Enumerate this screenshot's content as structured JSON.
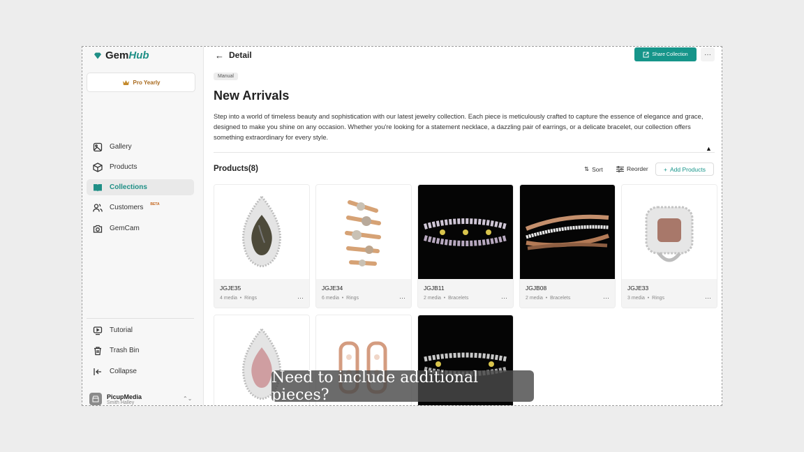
{
  "app": {
    "logo_main": "Gem",
    "logo_accent": "Hub",
    "plan": "Pro Yearly"
  },
  "sidebar": {
    "items": [
      {
        "label": "Gallery",
        "icon": "image-icon"
      },
      {
        "label": "Products",
        "icon": "box-icon"
      },
      {
        "label": "Collections",
        "icon": "book-icon",
        "active": true
      },
      {
        "label": "Customers",
        "icon": "users-icon",
        "badge": "BETA"
      },
      {
        "label": "GemCam",
        "icon": "camera-icon"
      }
    ],
    "bottom": [
      {
        "label": "Tutorial",
        "icon": "tutorial-icon"
      },
      {
        "label": "Trash Bin",
        "icon": "trash-icon"
      },
      {
        "label": "Collapse",
        "icon": "collapse-icon"
      }
    ],
    "account": {
      "name": "PicupMedia",
      "user": "Smith Halley"
    }
  },
  "header": {
    "title": "Detail",
    "share_label": "Share Collection"
  },
  "collection": {
    "tag": "Manual",
    "title": "New Arrivals",
    "description": "Step into a world of timeless beauty and sophistication with our latest jewelry collection. Each piece is meticulously crafted to capture the essence of elegance and grace, designed to make you shine on any occasion. Whether you're looking for a statement necklace, a dazzling pair of earrings, or a delicate bracelet, our collection offers something extraordinary for every style."
  },
  "products": {
    "heading": "Products(8)",
    "sort_label": "Sort",
    "reorder_label": "Reorder",
    "add_label": "Add Products",
    "items": [
      {
        "name": "JGJE35",
        "media": "4 media",
        "category": "Rings"
      },
      {
        "name": "JGJE34",
        "media": "6 media",
        "category": "Rings"
      },
      {
        "name": "JGJB11",
        "media": "2 media",
        "category": "Bracelets"
      },
      {
        "name": "JGJB08",
        "media": "2 media",
        "category": "Bracelets"
      },
      {
        "name": "JGJE33",
        "media": "3 media",
        "category": "Rings"
      }
    ]
  },
  "caption": "Need to include additional pieces?",
  "colors": {
    "accent": "#16958a",
    "beta": "#c4641a"
  }
}
